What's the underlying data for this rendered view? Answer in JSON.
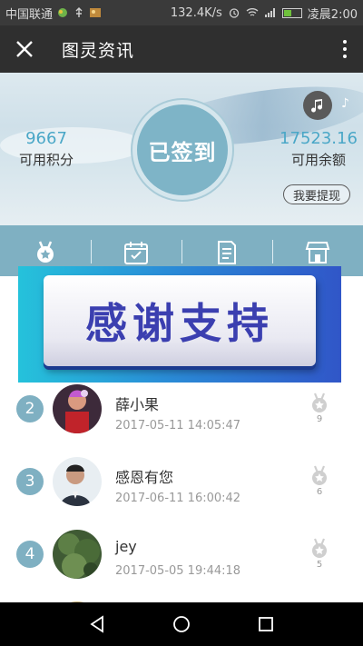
{
  "status_bar": {
    "carrier": "中国联通",
    "speed": "132.4K/s",
    "time": "凌晨2:00"
  },
  "app_bar": {
    "title": "图灵资讯"
  },
  "hero": {
    "points_value": "9667",
    "points_label": "可用积分",
    "sign_status": "已签到",
    "balance_value": "17523.16",
    "balance_label": "可用余额",
    "withdraw_label": "我要提现"
  },
  "tabs": [
    {
      "icon": "medal-icon"
    },
    {
      "icon": "calendar-icon"
    },
    {
      "icon": "document-icon"
    },
    {
      "icon": "shop-icon"
    }
  ],
  "banner": {
    "text": "感谢支持"
  },
  "rank_list": [
    {
      "rank": "2",
      "name": "薛小果",
      "time": "2017-05-11 14:05:47",
      "medal_count": "9"
    },
    {
      "rank": "3",
      "name": "感恩有您",
      "time": "2017-06-11 16:00:42",
      "medal_count": "6"
    },
    {
      "rank": "4",
      "name": "jey",
      "time": "2017-05-05 19:44:18",
      "medal_count": "5"
    }
  ],
  "colors": {
    "accent": "#7fb0c2",
    "stat_value": "#4aa7c7",
    "app_bar": "#2f2f2f"
  }
}
